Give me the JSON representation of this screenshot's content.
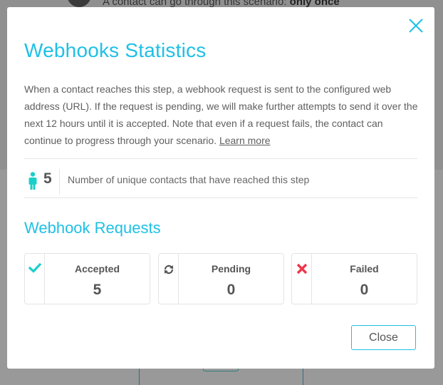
{
  "background": {
    "scenario_text": "A contact can go through this scenario: ",
    "scenario_emphasis": "only once",
    "scenario_icon": "flow-icon"
  },
  "modal": {
    "title": "Webhooks Statistics",
    "close_icon": "close-icon",
    "description": "When a contact reaches this step, a webhook request is sent to the configured web address (URL). If the request is pending, we will make further attempts to send it over the next 12 hours until it is accepted. Note that even if a request fails, the contact can continue to progress through your scenario. ",
    "learn_more_label": "Learn more",
    "contacts": {
      "icon": "person-icon",
      "count": "5",
      "label": "Number of unique contacts that have reached this step"
    },
    "requests_title": "Webhook Requests",
    "requests": [
      {
        "label": "Accepted",
        "value": "5",
        "icon": "check-icon",
        "color": "#1ccfc9"
      },
      {
        "label": "Pending",
        "value": "0",
        "icon": "refresh-icon",
        "color": "#555555"
      },
      {
        "label": "Failed",
        "value": "0",
        "icon": "cross-icon",
        "color": "#f0364a"
      }
    ],
    "close_button_label": "Close"
  },
  "colors": {
    "accent": "#1fc0e6",
    "success": "#1ccfc9",
    "danger": "#f0364a",
    "overlay": "#999999"
  }
}
